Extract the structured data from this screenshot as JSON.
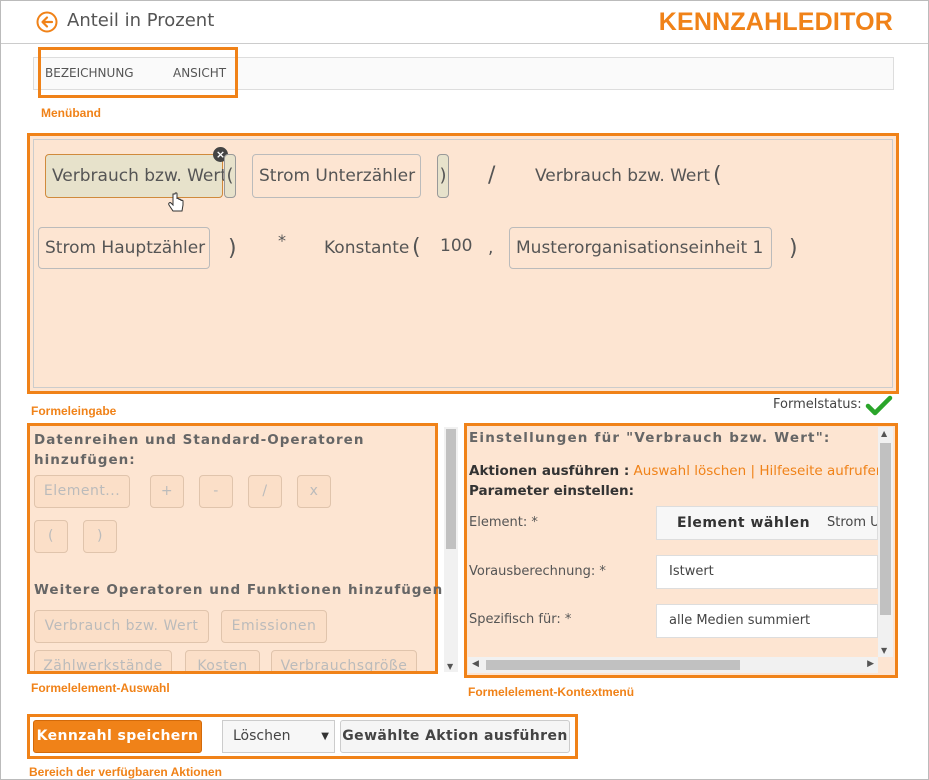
{
  "header": {
    "title": "Anteil in Prozent",
    "brand": "KENNZAHLEDITOR"
  },
  "menu": {
    "items": [
      "BEZEICHNUNG",
      "ANSICHT"
    ],
    "caption": "Menüband"
  },
  "formula": {
    "caption": "Formeleingabe",
    "tokens": {
      "t1": "Verbrauch bzw. Wert",
      "t2": "(",
      "t3": "Strom Unterzähler",
      "t4": ")",
      "t5": "/",
      "t6": "Verbrauch bzw. Wert",
      "t7": "(",
      "t8": "Strom Hauptzähler",
      "t9": ")",
      "t10": "*",
      "t11": "Konstante",
      "t12": "(",
      "t13": "100",
      "t14": ",",
      "t15": "Musterorganisationseinheit 1",
      "t16": ")"
    },
    "status_label": "Formelstatus:"
  },
  "selection_panel": {
    "caption": "Formelelement-Auswahl",
    "heading1": "Datenreihen und Standard-Operatoren hinzufügen:",
    "buttons_row1": [
      "Element...",
      "+",
      "-",
      "/",
      "x"
    ],
    "buttons_row2": [
      "(",
      ")"
    ],
    "heading2": "Weitere Operatoren und Funktionen hinzufügen:",
    "buttons_row3": [
      "Verbrauch bzw. Wert",
      "Emissionen"
    ],
    "buttons_row4": [
      "Zählwerkstände",
      "Kosten",
      "Verbrauchsgröße"
    ]
  },
  "context_panel": {
    "caption": "Formelelement-Kontextmenü",
    "heading": "Einstellungen für \"Verbrauch bzw. Wert\":",
    "actions_label": "Aktionen ausführen :",
    "action_clear": "Auswahl löschen",
    "separator": "|",
    "action_help": "Hilfeseite aufrufen",
    "params_label": "Parameter einstellen:",
    "element_label": "Element: *",
    "element_button": "Element wählen",
    "element_value": "Strom U",
    "forecast_label": "Vorausberechnung: *",
    "forecast_value": "Istwert",
    "specific_label": "Spezifisch für: *",
    "specific_value": "alle Medien summiert"
  },
  "actions": {
    "caption": "Bereich der verfügbaren Aktionen",
    "save_label": "Kennzahl speichern",
    "select_value": "Löschen",
    "execute_label": "Gewählte Aktion ausführen"
  },
  "colors": {
    "accent": "#f08218",
    "panel_bg": "#fde5d2",
    "status_ok": "#2aa52a"
  }
}
